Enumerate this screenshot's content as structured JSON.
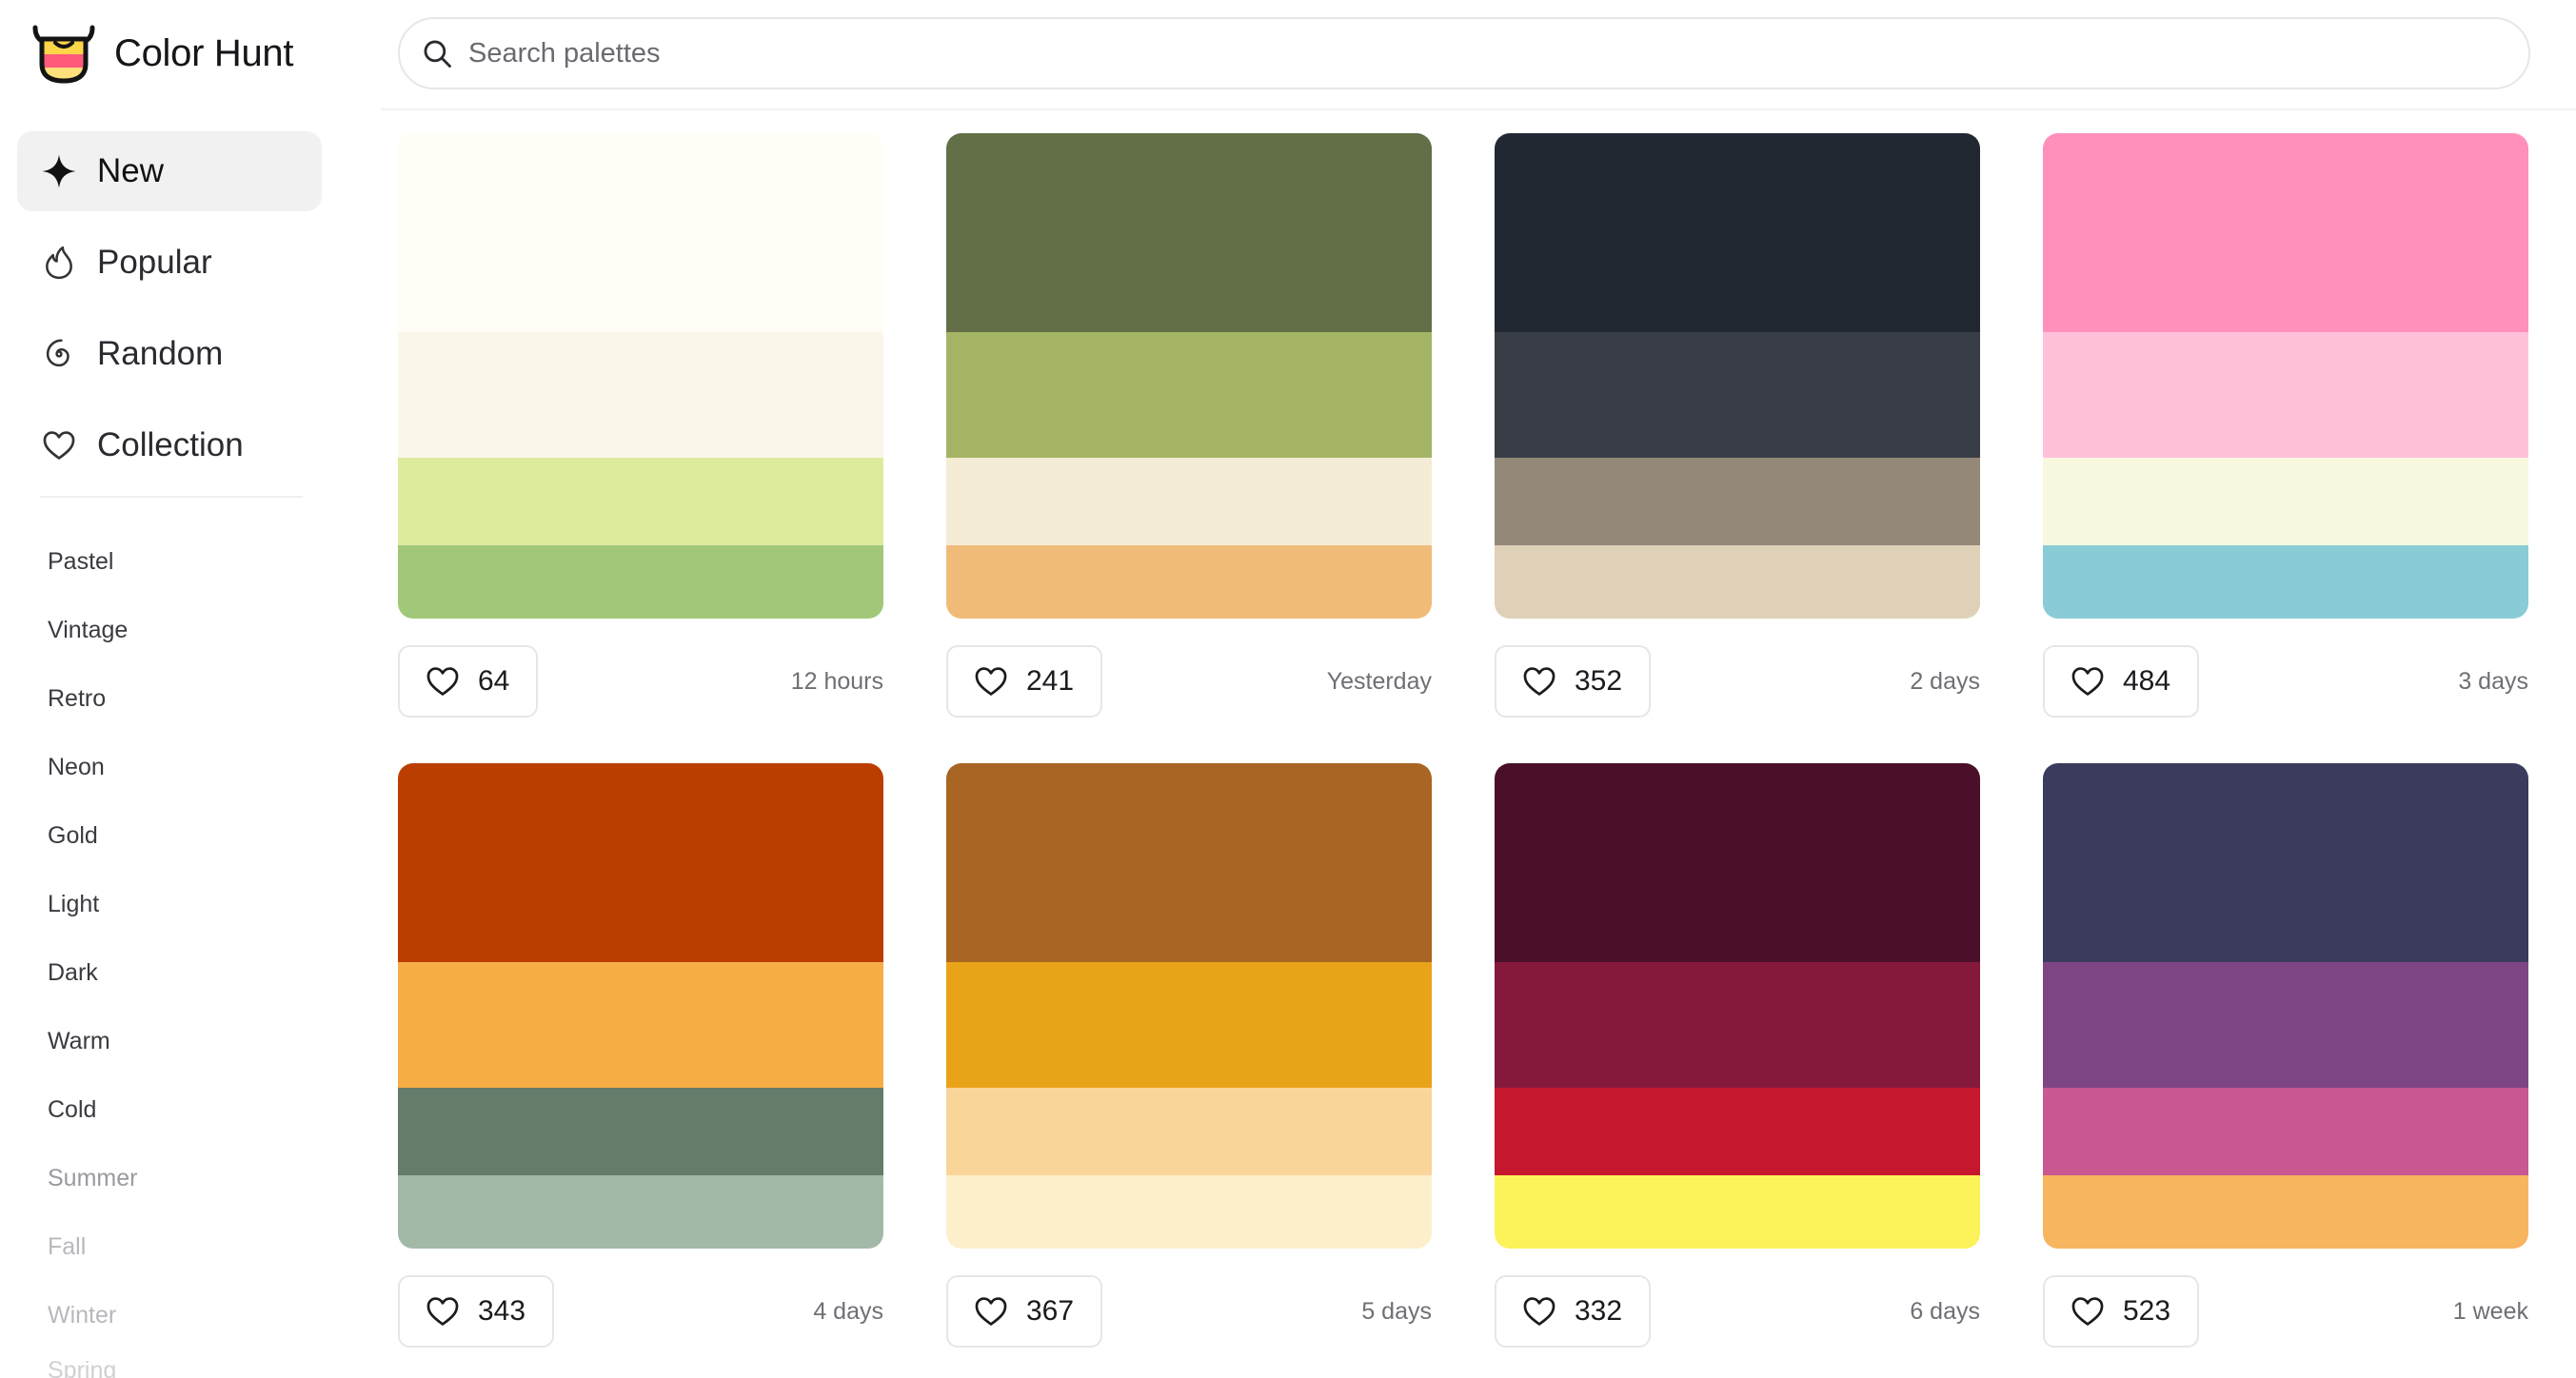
{
  "app": {
    "name": "Color Hunt"
  },
  "search": {
    "placeholder": "Search palettes",
    "value": ""
  },
  "nav": [
    {
      "label": "New",
      "icon": "sparkle-icon",
      "active": true
    },
    {
      "label": "Popular",
      "icon": "flame-icon",
      "active": false
    },
    {
      "label": "Random",
      "icon": "spiral-icon",
      "active": false
    },
    {
      "label": "Collection",
      "icon": "heart-icon",
      "active": false
    }
  ],
  "tags": [
    "Pastel",
    "Vintage",
    "Retro",
    "Neon",
    "Gold",
    "Light",
    "Dark",
    "Warm",
    "Cold",
    "Summer",
    "Fall",
    "Winter",
    "Spring"
  ],
  "palettes": [
    {
      "colors": [
        "#FFFDF6",
        "#FAF6E9",
        "#DDEB9D",
        "#A0C878"
      ],
      "likes": "64",
      "date": "12 hours"
    },
    {
      "colors": [
        "#626F47",
        "#A4B465",
        "#F5ECD5",
        "#F0BB78"
      ],
      "likes": "241",
      "date": "Yesterday"
    },
    {
      "colors": [
        "#222831",
        "#393E46",
        "#948979",
        "#DFD0B8"
      ],
      "likes": "352",
      "date": "2 days"
    },
    {
      "colors": [
        "#FF90BB",
        "#FFC1DA",
        "#F8F8E1",
        "#8ACCD5"
      ],
      "likes": "484",
      "date": "3 days"
    },
    {
      "colors": [
        "#BB3E00",
        "#F7AD45",
        "#657C6A",
        "#A2B9A7"
      ],
      "likes": "343",
      "date": "4 days"
    },
    {
      "colors": [
        "#A86523",
        "#E9A319",
        "#FAD59A",
        "#FCEFCB"
      ],
      "likes": "367",
      "date": "5 days"
    },
    {
      "colors": [
        "#4A102A",
        "#85193C",
        "#C5172E",
        "#FCF259"
      ],
      "likes": "332",
      "date": "6 days"
    },
    {
      "colors": [
        "#3B3B5E",
        "#7E4585",
        "#C95792",
        "#F8B55F"
      ],
      "likes": "523",
      "date": "1 week"
    }
  ]
}
